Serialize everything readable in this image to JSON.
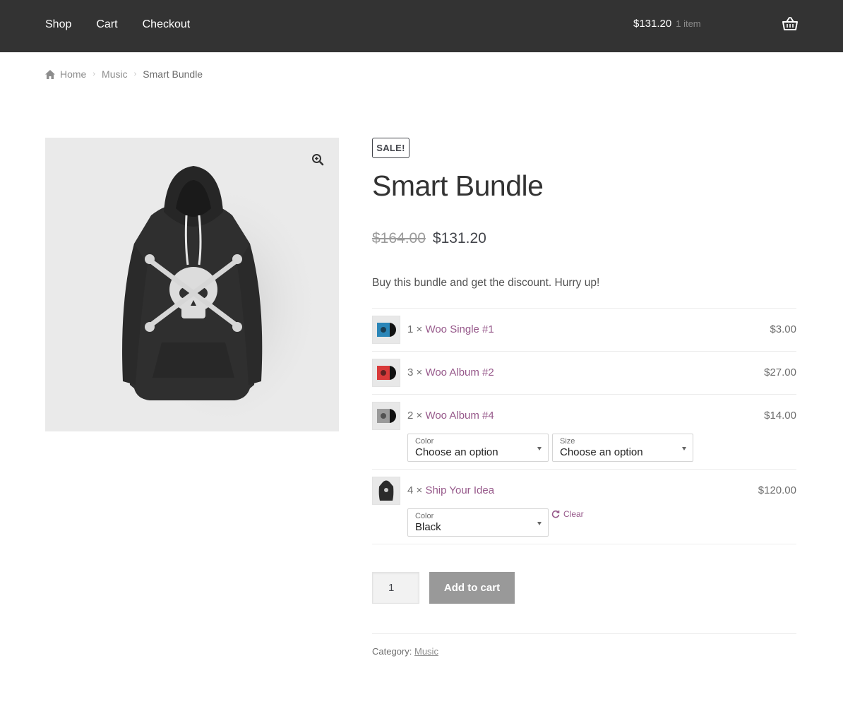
{
  "header": {
    "nav": [
      "Shop",
      "Cart",
      "Checkout"
    ],
    "cart_total": "$131.20",
    "cart_count": "1 item"
  },
  "breadcrumb": {
    "home": "Home",
    "category": "Music",
    "current": "Smart Bundle"
  },
  "product": {
    "badge": "SALE!",
    "title": "Smart Bundle",
    "old_price": "$164.00",
    "new_price": "$131.20",
    "description": "Buy this bundle and get the discount. Hurry up!",
    "bundle_items": [
      {
        "qty": "1 ×",
        "name": "Woo Single #1",
        "price": "$3.00",
        "thumb": "vinyl-blue-icon"
      },
      {
        "qty": "3 ×",
        "name": "Woo Album #2",
        "price": "$27.00",
        "thumb": "vinyl-red-icon"
      },
      {
        "qty": "2 ×",
        "name": "Woo Album #4",
        "price": "$14.00",
        "thumb": "vinyl-grey-icon",
        "selects": [
          {
            "label": "Color",
            "value": "Choose an option"
          },
          {
            "label": "Size",
            "value": "Choose an option"
          }
        ]
      },
      {
        "qty": "4 ×",
        "name": "Ship Your Idea",
        "price": "$120.00",
        "thumb": "hoodie-icon",
        "selects": [
          {
            "label": "Color",
            "value": "Black"
          }
        ],
        "clear": "Clear"
      }
    ],
    "quantity": "1",
    "add_to_cart": "Add to cart",
    "category_label": "Category:",
    "category_value": "Music"
  },
  "colors": {
    "header_bg": "#333333",
    "link": "#96588a",
    "button_disabled": "#999999"
  }
}
